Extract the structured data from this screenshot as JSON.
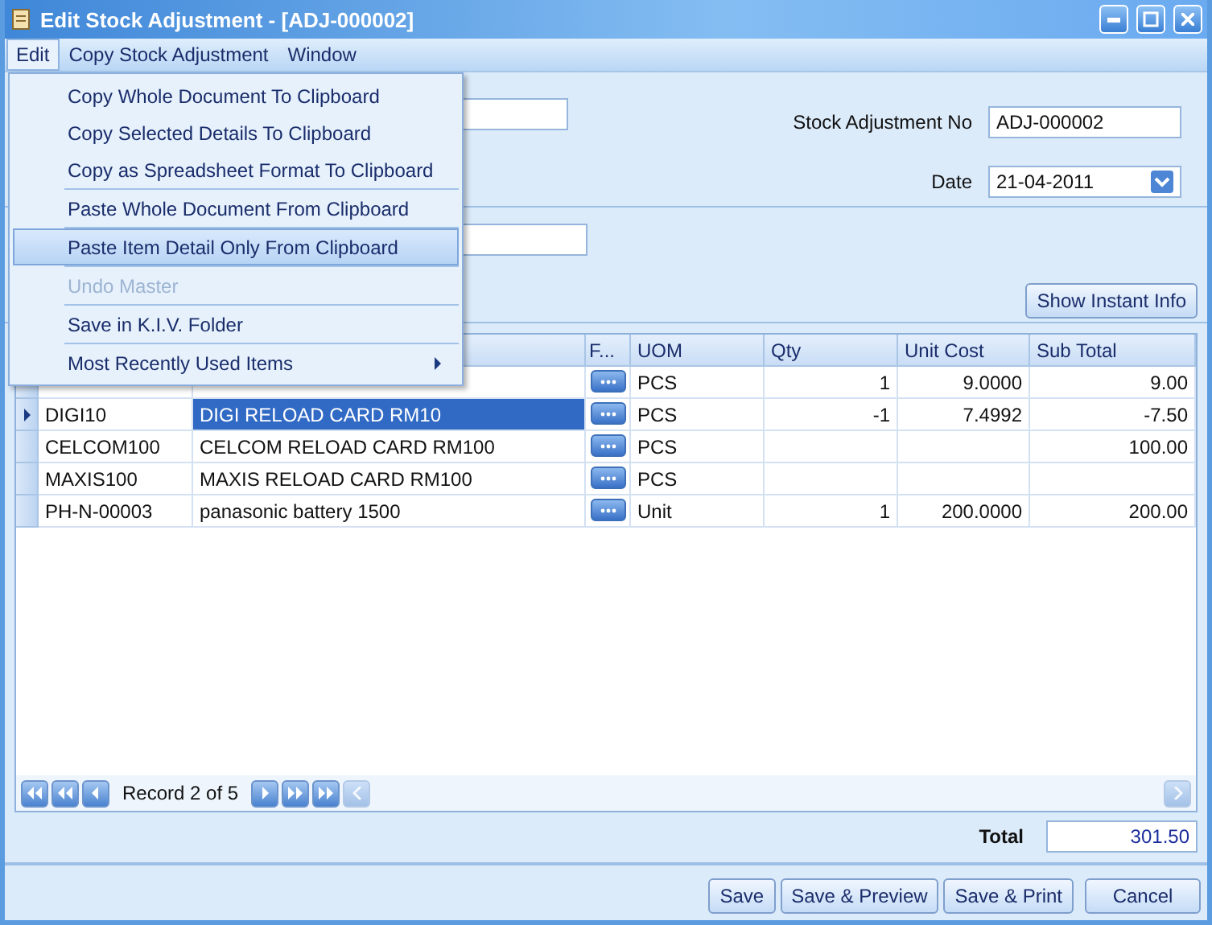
{
  "window": {
    "title": "Edit Stock Adjustment - [ADJ-000002]"
  },
  "menubar": [
    {
      "label": "Edit",
      "selected": true
    },
    {
      "label": "Copy Stock Adjustment",
      "selected": false
    },
    {
      "label": "Window",
      "selected": false
    }
  ],
  "menu": {
    "groups": [
      [
        {
          "label": "Copy Whole Document To Clipboard",
          "selected": false,
          "disabled": false,
          "submenu": false
        },
        {
          "label": "Copy Selected Details To Clipboard",
          "selected": false,
          "disabled": false,
          "submenu": false
        },
        {
          "label": "Copy as Spreadsheet Format To Clipboard",
          "selected": false,
          "disabled": false,
          "submenu": false
        }
      ],
      [
        {
          "label": "Paste Whole Document From Clipboard",
          "selected": false,
          "disabled": false,
          "submenu": false
        }
      ],
      [
        {
          "label": "Paste Item Detail Only From Clipboard",
          "selected": true,
          "disabled": false,
          "submenu": false
        }
      ],
      [
        {
          "label": "Undo Master",
          "selected": false,
          "disabled": true,
          "submenu": false
        }
      ],
      [
        {
          "label": "Save in K.I.V. Folder",
          "selected": false,
          "disabled": false,
          "submenu": false
        }
      ],
      [
        {
          "label": "Most Recently Used Items",
          "selected": false,
          "disabled": false,
          "submenu": true
        }
      ]
    ]
  },
  "header": {
    "stock_adjustment_no": {
      "label": "Stock Adjustment No",
      "value": "ADJ-000002"
    },
    "date": {
      "label": "Date",
      "value": "21-04-2011"
    }
  },
  "show_instant_info": "Show Instant Info",
  "table": {
    "columns": [
      "F...",
      "UOM",
      "Qty",
      "Unit Cost",
      "Sub Total"
    ],
    "rows": [
      {
        "selected": false,
        "item_code": "",
        "description": "",
        "uom": "PCS",
        "qty": "1",
        "unit_cost": "9.0000",
        "sub_total": "9.00"
      },
      {
        "selected": true,
        "item_code": "DIGI10",
        "description": "DIGI RELOAD CARD RM10",
        "uom": "PCS",
        "qty": "-1",
        "unit_cost": "7.4992",
        "sub_total": "-7.50"
      },
      {
        "selected": false,
        "item_code": "CELCOM100",
        "description": "CELCOM RELOAD CARD RM100",
        "uom": "PCS",
        "qty": "",
        "unit_cost": "",
        "sub_total": "100.00"
      },
      {
        "selected": false,
        "item_code": "MAXIS100",
        "description": "MAXIS RELOAD CARD RM100",
        "uom": "PCS",
        "qty": "",
        "unit_cost": "",
        "sub_total": ""
      },
      {
        "selected": false,
        "item_code": "PH-N-00003",
        "description": "panasonic battery 1500",
        "uom": "Unit",
        "qty": "1",
        "unit_cost": "200.0000",
        "sub_total": "200.00"
      }
    ]
  },
  "navigator": {
    "record": "Record 2 of 5"
  },
  "total": {
    "label": "Total",
    "value": "301.50"
  },
  "buttons": [
    "Save",
    "Save & Preview",
    "Save & Print",
    "Cancel"
  ]
}
